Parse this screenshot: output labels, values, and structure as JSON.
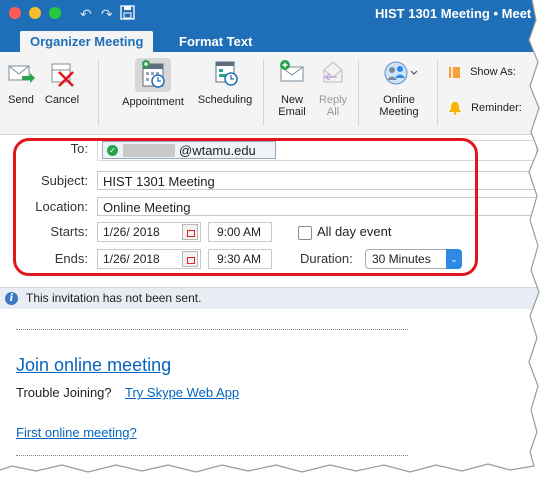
{
  "window": {
    "title": "HIST 1301 Meeting • Meet"
  },
  "tabs": [
    {
      "label": "Organizer Meeting",
      "active": true
    },
    {
      "label": "Format Text",
      "active": false
    }
  ],
  "ribbon": {
    "send": "Send",
    "cancel": "Cancel",
    "appointment": "Appointment",
    "scheduling": "Scheduling",
    "new_email": "New\nEmail",
    "reply_all": "Reply\nAll",
    "online_meeting": "Online\nMeeting",
    "show_as": "Show As:",
    "reminder": "Reminder:"
  },
  "form": {
    "to_label": "To:",
    "to_value": "@wtamu.edu",
    "subject_label": "Subject:",
    "subject_value": "HIST 1301 Meeting",
    "location_label": "Location:",
    "location_value": "Online Meeting",
    "starts_label": "Starts:",
    "start_date": "1/26/ 2018",
    "start_time": "9:00 AM",
    "all_day_label": "All day event",
    "ends_label": "Ends:",
    "end_date": "1/26/ 2018",
    "end_time": "9:30 AM",
    "duration_label": "Duration:",
    "duration_value": "30 Minutes"
  },
  "info_bar": {
    "message": "This invitation has not been sent."
  },
  "body": {
    "join_link": "Join online meeting",
    "trouble_text": "Trouble Joining?",
    "skype_link": "Try Skype Web App",
    "first_meeting_link": "First online meeting?"
  },
  "colors": {
    "accent": "#1f6fb8",
    "link": "#0563c1",
    "highlight": "#e0171f"
  }
}
